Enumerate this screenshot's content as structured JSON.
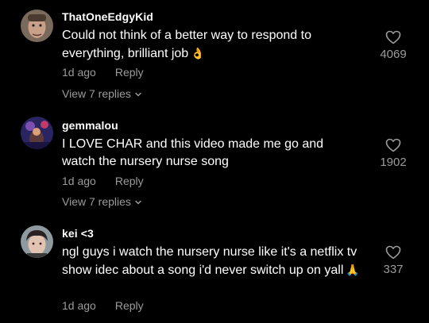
{
  "comments": [
    {
      "username": "ThatOneEdgyKid",
      "text": "Could not think of a better way to respond to everything, brilliant job",
      "emoji": "👌",
      "time": "1d ago",
      "reply_label": "Reply",
      "view_replies": "View 7 replies",
      "likes": "4069"
    },
    {
      "username": "gemmalou",
      "text": "I LOVE CHAR and this video made me go and watch the nursery nurse song",
      "emoji": "",
      "time": "1d ago",
      "reply_label": "Reply",
      "view_replies": "View 7 replies",
      "likes": "1902"
    },
    {
      "username": "kei <3",
      "text": "ngl guys i watch the nursery nurse like it's a netflix tv show idec about a song i'd never switch up on yall",
      "emoji": "🙏",
      "time": "1d ago",
      "reply_label": "Reply",
      "view_replies": "",
      "likes": "337"
    }
  ],
  "icons": {
    "like": "heart-outline-icon",
    "expand": "chevron-down-icon"
  },
  "colors": {
    "background": "#000000",
    "text": "#ffffff",
    "secondary": "#9b9b9b"
  }
}
